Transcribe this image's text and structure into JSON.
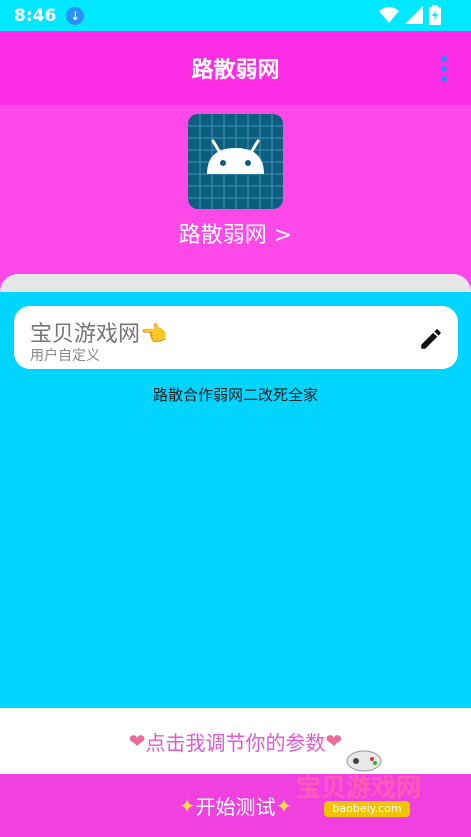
{
  "status_bar": {
    "time": "8:46"
  },
  "app_bar": {
    "title": "路散弱网"
  },
  "header": {
    "app_name": "路散弱网 >"
  },
  "card": {
    "title": "宝贝游戏网👈",
    "subtitle": "用户自定义"
  },
  "hint": "路散合作弱网二改死全家",
  "buttons": {
    "adjust": "点击我调节你的参数",
    "start": "开始测试"
  },
  "watermark": {
    "text": "宝贝游戏网",
    "url": "baobeiy.com"
  },
  "colors": {
    "status_bar": "#00e8ff",
    "app_bar": "#ff2ee6",
    "header": "#ff48e8",
    "main": "#00d4ff",
    "start_button": "#f040e0"
  }
}
